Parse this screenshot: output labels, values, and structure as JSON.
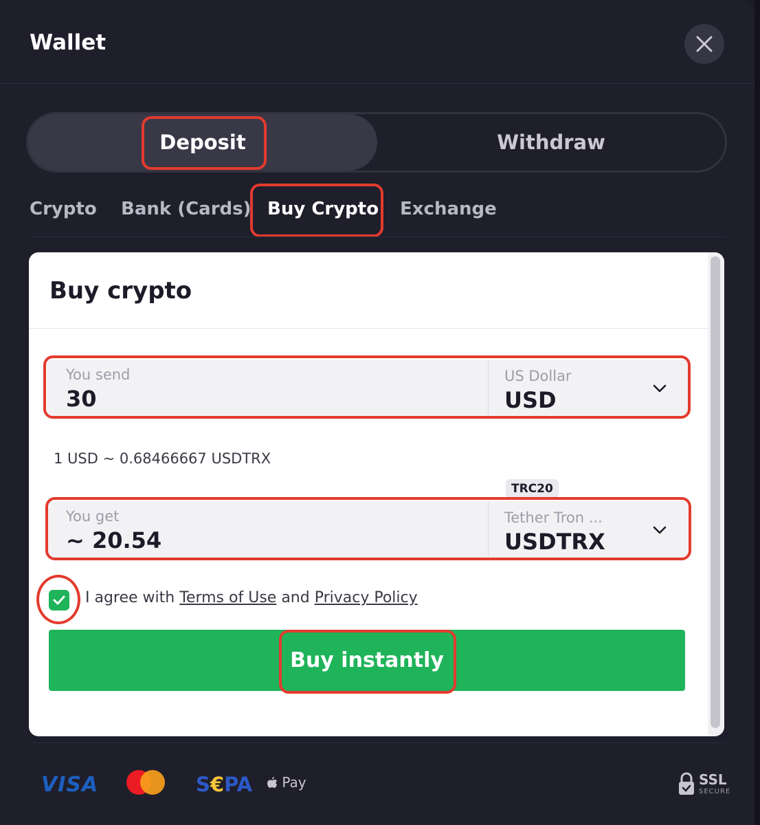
{
  "header": {
    "title": "Wallet"
  },
  "mode_toggle": {
    "deposit": "Deposit",
    "withdraw": "Withdraw",
    "active": "Deposit"
  },
  "subtabs": {
    "crypto": "Crypto",
    "bank": "Bank (Cards)",
    "buy_crypto": "Buy Crypto",
    "exchange": "Exchange",
    "active": "Buy Crypto"
  },
  "card": {
    "title": "Buy crypto",
    "send": {
      "label": "You send",
      "value": "30",
      "currency_name": "US Dollar",
      "currency_code": "USD"
    },
    "rate": "1 USD ~ 0.68466667 USDTRX",
    "get": {
      "label": "You get",
      "value": "~ 20.54",
      "network_badge": "TRC20",
      "currency_name": "Tether Tron ...",
      "currency_code": "USDTRX"
    },
    "agree": {
      "prefix": "I agree with",
      "terms": "Terms of Use",
      "and": "and",
      "privacy": "Privacy Policy",
      "checked": true
    },
    "buy_button": "Buy instantly"
  },
  "footer": {
    "visa": "VISA",
    "sepa_s": "S",
    "sepa_euro": "€",
    "sepa_pa": "PA",
    "apple_pay": "Pay",
    "ssl": "SSL",
    "ssl_sub": "SECURE"
  },
  "colors": {
    "accent_green": "#1fb35a",
    "highlight_red": "#e23b2e",
    "background": "#1f1e2b"
  },
  "icons": [
    "close-icon",
    "chevron-down-icon",
    "check-icon",
    "apple-icon",
    "lock-icon",
    "mastercard-icon"
  ]
}
